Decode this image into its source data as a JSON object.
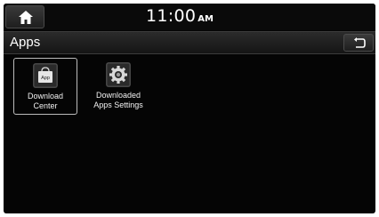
{
  "status_bar": {
    "time": "11:00",
    "ampm": "AM",
    "home_icon": "home-icon"
  },
  "header": {
    "title": "Apps",
    "back_icon": "back-arrow-icon"
  },
  "apps": [
    {
      "label_line1": "Download",
      "label_line2": "Center",
      "icon_text": "App",
      "icon": "shopping-bag-icon",
      "selected": true
    },
    {
      "label_line1": "Downloaded",
      "label_line2": "Apps Settings",
      "icon": "gear-icon",
      "selected": false
    }
  ],
  "colors": {
    "background": "#050505",
    "text": "#ffffff",
    "selection_border": "#bcbcbc"
  }
}
